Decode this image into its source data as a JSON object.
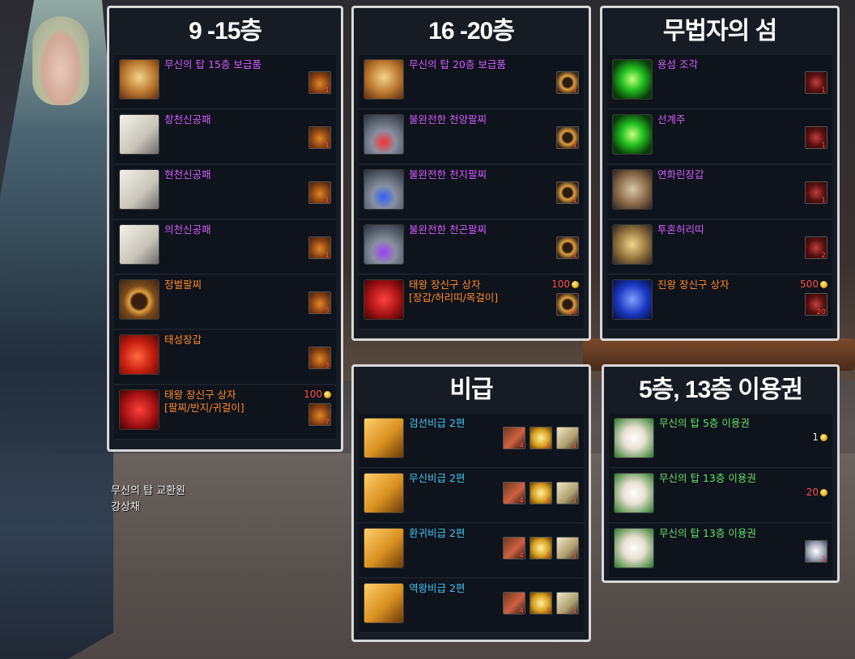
{
  "npc": {
    "name_line1": "무신의 탑 교환원",
    "name_line2": "강상채"
  },
  "panels": [
    {
      "title": "9 -15층",
      "rows": [
        {
          "name": "무신의 탑 15층 보급품",
          "color": "purple",
          "icon": "chest-icon",
          "costs": [
            {
              "icon": "gourd-icon",
              "qty": "1"
            }
          ]
        },
        {
          "name": "창천신공패",
          "color": "purple",
          "icon": "scroll-icon",
          "costs": [
            {
              "icon": "gourd-icon",
              "qty": "1"
            }
          ]
        },
        {
          "name": "현천신공패",
          "color": "purple",
          "icon": "scroll-icon",
          "costs": [
            {
              "icon": "gourd-icon",
              "qty": "1"
            }
          ]
        },
        {
          "name": "의천신공패",
          "color": "purple",
          "icon": "scroll-icon",
          "costs": [
            {
              "icon": "gourd-icon",
              "qty": "1"
            }
          ]
        },
        {
          "name": "정벌팔찌",
          "color": "orange",
          "icon": "bracelet-icon",
          "costs": [
            {
              "icon": "gourd-icon",
              "qty": "3"
            }
          ]
        },
        {
          "name": "태성장갑",
          "color": "orange",
          "icon": "glove-icon",
          "costs": [
            {
              "icon": "gourd-icon",
              "qty": "3"
            }
          ]
        },
        {
          "name": "태왕 장신구 상자",
          "name2": "[팔찌/반지/귀걸이]",
          "color": "orange",
          "icon": "red-box-icon",
          "money": "100",
          "costs": [
            {
              "icon": "gourd-icon",
              "qty": "7"
            }
          ]
        }
      ]
    },
    {
      "title": "16 -20층",
      "rows": [
        {
          "name": "무신의 탑 20층 보급품",
          "color": "purple",
          "icon": "chest-icon",
          "costs": [
            {
              "icon": "ring-icon",
              "qty": "1"
            }
          ]
        },
        {
          "name": "불완전한 천양팔찌",
          "color": "purple",
          "icon": "silver-bracelet-red-icon",
          "costs": [
            {
              "icon": "ring-icon",
              "qty": "1"
            }
          ]
        },
        {
          "name": "불완전한 천지팔찌",
          "color": "purple",
          "icon": "silver-bracelet-blue-icon",
          "costs": [
            {
              "icon": "ring-icon",
              "qty": "1"
            }
          ]
        },
        {
          "name": "불완전한 천곤팔찌",
          "color": "purple",
          "icon": "silver-bracelet-purple-icon",
          "costs": [
            {
              "icon": "ring-icon",
              "qty": "1"
            }
          ]
        },
        {
          "name": "태왕 장신구 상자",
          "name2": "[장갑/허리띠/목걸이]",
          "color": "orange",
          "icon": "red-box-icon",
          "money": "100",
          "costs": [
            {
              "icon": "ring-icon",
              "qty": "10"
            }
          ]
        }
      ]
    },
    {
      "title": "무법자의 섬",
      "rows": [
        {
          "name": "용섬 조각",
          "color": "purple",
          "icon": "green-gem-icon",
          "costs": [
            {
              "icon": "dark-token-icon",
              "qty": "1"
            }
          ]
        },
        {
          "name": "선계주",
          "color": "purple",
          "icon": "green-orb-icon",
          "costs": [
            {
              "icon": "dark-token-icon",
              "qty": "1"
            }
          ]
        },
        {
          "name": "연화린장갑",
          "color": "purple",
          "icon": "gauntlet-icon",
          "costs": [
            {
              "icon": "dark-token-icon",
              "qty": "1"
            }
          ]
        },
        {
          "name": "투혼허리띠",
          "color": "purple",
          "icon": "belt-icon",
          "costs": [
            {
              "icon": "dark-token-icon",
              "qty": "2"
            }
          ]
        },
        {
          "name": "진왕 장신구 상자",
          "color": "orange",
          "icon": "blue-box-icon",
          "money": "500",
          "costs": [
            {
              "icon": "dark-token-icon",
              "qty": "20"
            }
          ]
        }
      ]
    },
    {
      "title": "비급",
      "rows": [
        {
          "name": "검선비급 2편",
          "color": "cyan",
          "icon": "book-icon",
          "costs": [
            {
              "icon": "scroll-bundle-icon",
              "qty": "4"
            },
            {
              "icon": "gold-token-icon",
              "qty": "1"
            },
            {
              "icon": "paper-icon",
              "qty": "1"
            }
          ]
        },
        {
          "name": "무신비급 2편",
          "color": "cyan",
          "icon": "book-icon",
          "costs": [
            {
              "icon": "scroll-bundle-icon",
              "qty": "4"
            },
            {
              "icon": "gold-token-icon",
              "qty": "1"
            },
            {
              "icon": "paper-icon",
              "qty": "1"
            }
          ]
        },
        {
          "name": "환귀비급 2편",
          "color": "cyan",
          "icon": "book-icon",
          "costs": [
            {
              "icon": "scroll-bundle-icon",
              "qty": "4"
            },
            {
              "icon": "gold-token-icon",
              "qty": "1"
            },
            {
              "icon": "paper-icon",
              "qty": "1"
            }
          ]
        },
        {
          "name": "역왕비급 2편",
          "color": "cyan",
          "icon": "book-icon",
          "costs": [
            {
              "icon": "scroll-bundle-icon",
              "qty": "4"
            },
            {
              "icon": "gold-token-icon",
              "qty": "1"
            },
            {
              "icon": "paper-icon",
              "qty": "1"
            }
          ]
        }
      ]
    },
    {
      "title": "5층, 13층 이용권",
      "rows": [
        {
          "name": "무신의 탑 5층 이용권",
          "color": "green",
          "icon": "ticket-scroll-icon",
          "money": "1",
          "money_color": "white",
          "costs": []
        },
        {
          "name": "무신의 탑 13층 이용권",
          "color": "green",
          "icon": "ticket-scroll-icon",
          "money": "20",
          "money_color": "red",
          "costs": []
        },
        {
          "name": "무신의 탑 13층 이용권",
          "color": "green",
          "icon": "ticket-scroll-icon",
          "costs": [
            {
              "icon": "silver-tag-icon",
              "qty": "1"
            }
          ]
        }
      ]
    }
  ]
}
